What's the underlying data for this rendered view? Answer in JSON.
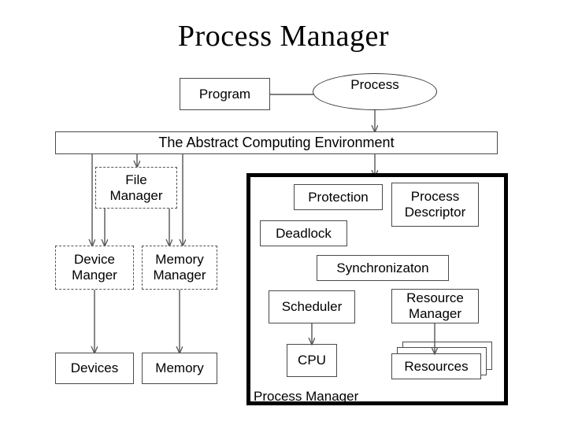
{
  "title": "Process Manager",
  "top_row": {
    "program": {
      "label": "Program"
    },
    "process": {
      "label": "Process"
    }
  },
  "ace_bar": {
    "label": "The Abstract Computing Environment"
  },
  "left_column": {
    "file_manager": {
      "label": "File\nManager",
      "line1": "File",
      "line2": "Manager"
    },
    "device_manager": {
      "label": "Device\nManger",
      "line1": "Device",
      "line2": "Manger"
    },
    "memory_manager": {
      "label": "Memory\nManager",
      "line1": "Memory",
      "line2": "Manager"
    },
    "devices": {
      "label": "Devices"
    },
    "memory": {
      "label": "Memory"
    }
  },
  "process_manager_panel": {
    "label": "Process Manager",
    "items": {
      "protection": {
        "label": "Protection"
      },
      "process_descriptor": {
        "line1": "Process",
        "line2": "Descriptor"
      },
      "deadlock": {
        "label": "Deadlock"
      },
      "synchronization": {
        "label": "Synchronizaton"
      },
      "scheduler": {
        "label": "Scheduler"
      },
      "resource_manager": {
        "line1": "Resource",
        "line2": "Manager"
      },
      "cpu": {
        "label": "CPU"
      },
      "resources": {
        "label": "Resources"
      }
    }
  },
  "colors": {
    "background": "#ffffff",
    "ink": "#000000",
    "box_border": "#4a4a4a",
    "dashed_border": "#555555",
    "panel_border": "#000000",
    "wire": "#555555"
  }
}
